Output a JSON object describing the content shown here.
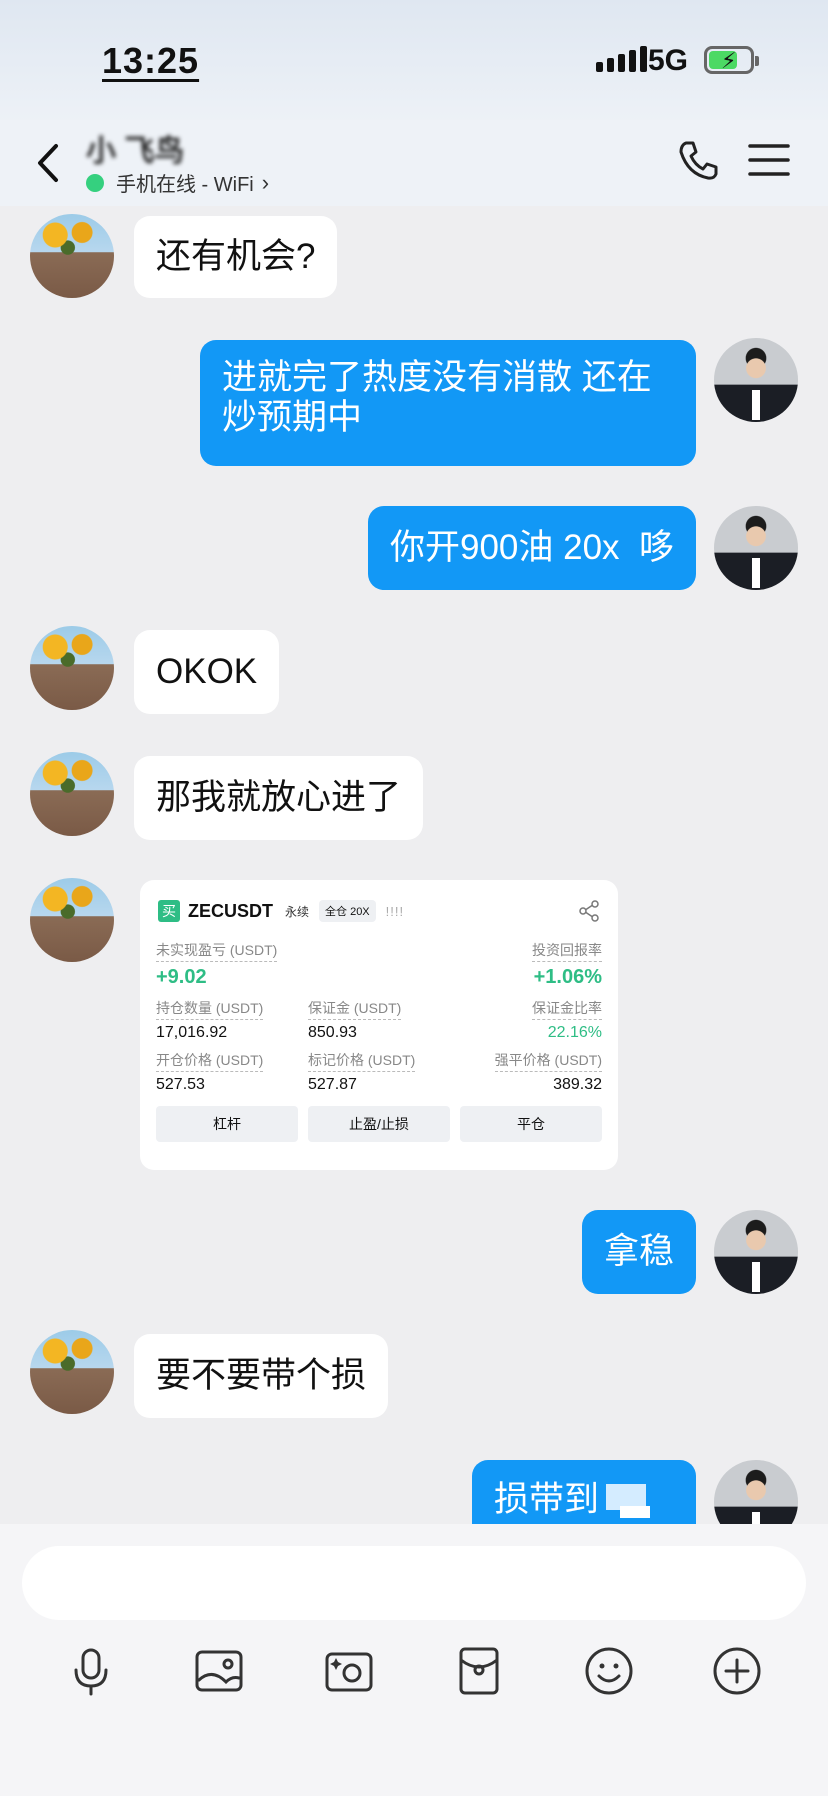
{
  "status_bar": {
    "time": "13:25",
    "network": "5G"
  },
  "header": {
    "contact_name": "小 飞鸟",
    "online_status": "手机在线 - WiFi"
  },
  "messages": [
    {
      "side": "left",
      "text": "还有机会?"
    },
    {
      "side": "right",
      "text": "进就完了热度没有消散 还在炒预期中"
    },
    {
      "side": "right",
      "text": "你开900油 20x  哆"
    },
    {
      "side": "left",
      "text": "OKOK"
    },
    {
      "side": "left",
      "text": "那我就放心进了"
    },
    {
      "side": "left",
      "type": "image",
      "text": ""
    },
    {
      "side": "right",
      "text": "拿稳"
    },
    {
      "side": "left",
      "text": "要不要带个损"
    },
    {
      "side": "right",
      "text": "损带到"
    }
  ],
  "trade_card": {
    "badge": "买",
    "symbol": "ZECUSDT",
    "contract_type": "永续",
    "margin_mode": "全仓 20X",
    "bars": "!!!!",
    "unrealized_pnl_label": "未实现盈亏 (USDT)",
    "unrealized_pnl": "+9.02",
    "roi_label": "投资回报率",
    "roi": "+1.06%",
    "position_qty_label": "持仓数量 (USDT)",
    "position_qty": "17,016.92",
    "margin_label": "保证金 (USDT)",
    "margin": "850.93",
    "margin_ratio_label": "保证金比率",
    "margin_ratio": "22.16%",
    "entry_price_label": "开仓价格 (USDT)",
    "entry_price": "527.53",
    "mark_price_label": "标记价格 (USDT)",
    "mark_price": "527.87",
    "liq_price_label": "强平价格 (USDT)",
    "liq_price": "389.32",
    "buttons": [
      "杠杆",
      "止盈/止损",
      "平仓"
    ]
  },
  "toolbar_icons": [
    "microphone-icon",
    "image-icon",
    "camera-icon",
    "red-packet-icon",
    "emoji-icon",
    "plus-icon"
  ],
  "colors": {
    "bubble_blue": "#1298f6",
    "online_green": "#35d07f",
    "profit_green": "#2ebd85"
  }
}
